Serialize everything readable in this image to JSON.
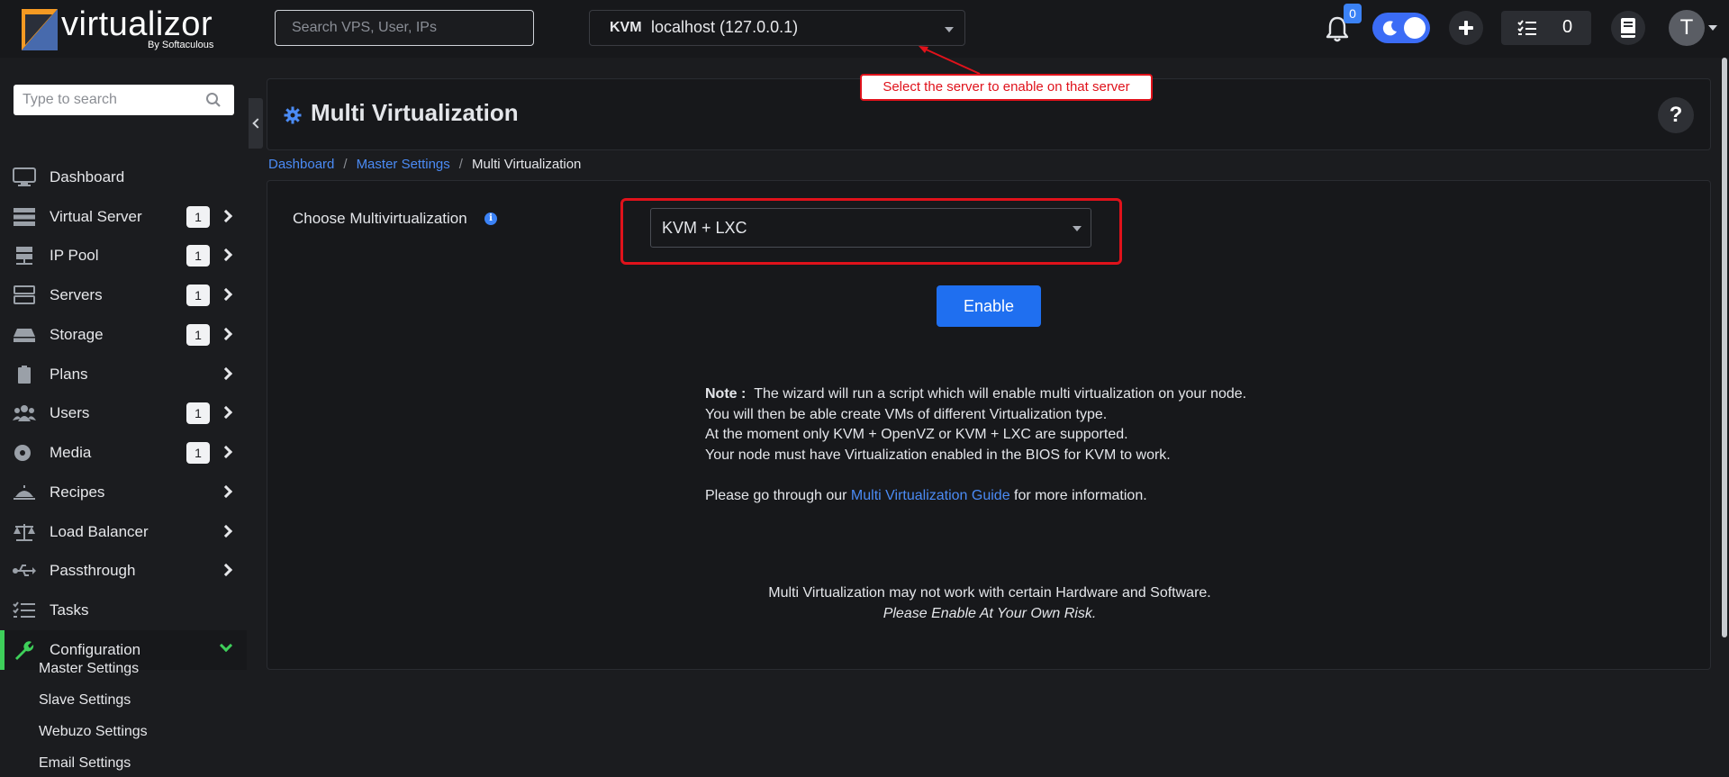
{
  "brand": {
    "name": "virtualizor",
    "sub": "By Softaculous"
  },
  "topbar": {
    "search_placeholder": "Search VPS, User, IPs",
    "server": {
      "type": "KVM",
      "name": "localhost (127.0.0.1)"
    },
    "notifications": "0",
    "tasks_count": "0",
    "avatar_initial": "T"
  },
  "sidebar": {
    "search_placeholder": "Type to search",
    "items": [
      {
        "label": "Dashboard",
        "badge": "",
        "icon": "monitor-icon"
      },
      {
        "label": "Virtual Server",
        "badge": "1",
        "icon": "server-stack-icon"
      },
      {
        "label": "IP Pool",
        "badge": "1",
        "icon": "ip-pool-icon"
      },
      {
        "label": "Servers",
        "badge": "1",
        "icon": "servers-icon"
      },
      {
        "label": "Storage",
        "badge": "1",
        "icon": "hdd-icon"
      },
      {
        "label": "Plans",
        "badge": "",
        "icon": "clipboard-icon"
      },
      {
        "label": "Users",
        "badge": "1",
        "icon": "users-icon"
      },
      {
        "label": "Media",
        "badge": "1",
        "icon": "disc-icon"
      },
      {
        "label": "Recipes",
        "badge": "",
        "icon": "dish-icon"
      },
      {
        "label": "Load Balancer",
        "badge": "",
        "icon": "balance-scale-icon"
      },
      {
        "label": "Passthrough",
        "badge": "",
        "icon": "usb-icon"
      },
      {
        "label": "Tasks",
        "badge": "",
        "icon": "tasks-icon"
      },
      {
        "label": "Configuration",
        "badge": "",
        "icon": "wrench-icon"
      }
    ],
    "sub_items": [
      "Master Settings",
      "Slave Settings",
      "Webuzo Settings",
      "Email Settings"
    ]
  },
  "page": {
    "title": "Multi Virtualization",
    "annotation": "Select the server to enable on that server"
  },
  "breadcrumb": {
    "home": "Dashboard",
    "parent": "Master Settings",
    "current": "Multi Virtualization",
    "separator": "/"
  },
  "form": {
    "label": "Choose Multivirtualization",
    "value": "KVM + LXC",
    "enable_label": "Enable"
  },
  "note": {
    "label": "Note :",
    "lines": [
      "The wizard will run a script which will enable multi virtualization on your node.",
      "You will then be able create VMs of different Virtualization type.",
      "At the moment only KVM + OpenVZ or KVM + LXC are supported.",
      "Your node must have Virtualization enabled in the BIOS for KVM to work."
    ],
    "guide_prefix": "Please go through our",
    "guide_link": "Multi Virtualization Guide",
    "guide_suffix": "for more information."
  },
  "warning": {
    "line1": "Multi Virtualization may not work with certain Hardware and Software.",
    "line2": "Please Enable At Your Own Risk."
  },
  "colors": {
    "accent": "#1f6ff0",
    "active": "#3ecf5a",
    "alert": "#e0121b"
  }
}
